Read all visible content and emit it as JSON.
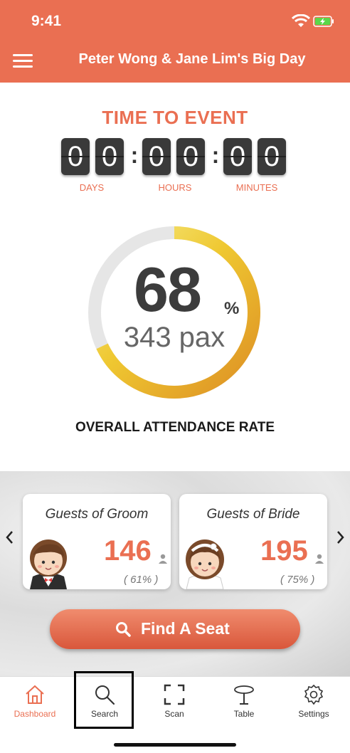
{
  "status": {
    "time": "9:41"
  },
  "header": {
    "title": "Peter Wong & Jane Lim's Big Day"
  },
  "countdown": {
    "heading": "TIME TO EVENT",
    "digits": [
      "0",
      "0",
      "0",
      "0",
      "0",
      "0"
    ],
    "units": [
      "DAYS",
      "HOURS",
      "MINUTES"
    ]
  },
  "attendance": {
    "percent": "68",
    "percent_sign": "%",
    "pax": "343 pax",
    "label": "OVERALL ATTENDANCE RATE",
    "rate": 0.68
  },
  "guests": {
    "groom": {
      "title": "Guests of Groom",
      "count": "146",
      "pct": "( 61% )"
    },
    "bride": {
      "title": "Guests of Bride",
      "count": "195",
      "pct": "( 75% )"
    }
  },
  "find_button": {
    "label": "Find A Seat"
  },
  "tabs": [
    {
      "label": "Dashboard",
      "icon": "home-icon",
      "active": true
    },
    {
      "label": "Search",
      "icon": "search-icon"
    },
    {
      "label": "Scan",
      "icon": "scan-icon"
    },
    {
      "label": "Table",
      "icon": "table-icon"
    },
    {
      "label": "Settings",
      "icon": "gear-icon"
    }
  ],
  "colors": {
    "accent": "#ea6f52",
    "gauge_start": "#e0962a",
    "gauge_end": "#f3e03a"
  }
}
